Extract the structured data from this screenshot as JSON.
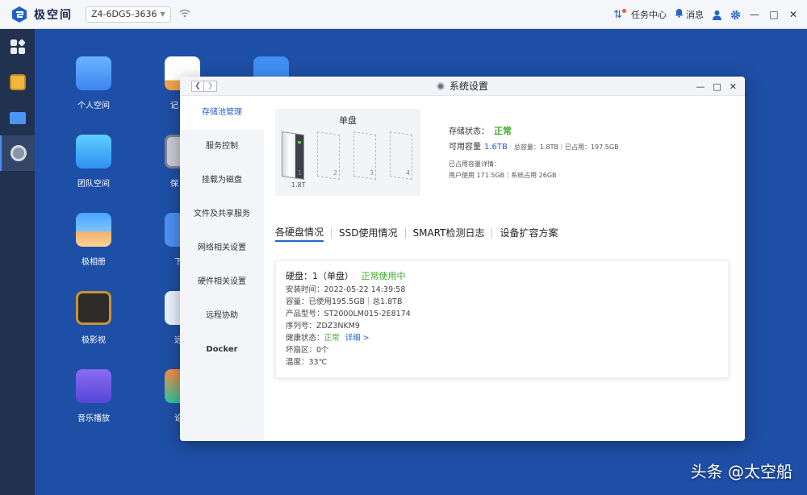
{
  "topbar": {
    "app_name": "极空间",
    "device": "Z4-6DG5-3636",
    "task_center": "任务中心",
    "messages": "消息"
  },
  "desktop": {
    "icons": [
      {
        "label": "个人空间",
        "icon": "folder-icon"
      },
      {
        "label": "团队空间",
        "icon": "team-folder-icon"
      },
      {
        "label": "极相册",
        "icon": "photo-album-icon"
      },
      {
        "label": "极影视",
        "icon": "video-icon"
      },
      {
        "label": "音乐播放",
        "icon": "music-icon"
      },
      {
        "label": "记",
        "icon": "notes-icon"
      },
      {
        "label": "保",
        "icon": "safe-icon"
      },
      {
        "label": "下",
        "icon": "download-icon"
      },
      {
        "label": "远",
        "icon": "remote-icon"
      },
      {
        "label": "论",
        "icon": "chat-icon"
      }
    ]
  },
  "window": {
    "title": "系统设置",
    "menu": [
      "存储池管理",
      "服务控制",
      "挂载为磁盘",
      "文件及共享服务",
      "网络相关设置",
      "硬件相关设置",
      "远程协助",
      "Docker"
    ],
    "disk_panel": {
      "title": "单盘",
      "bays": [
        "1",
        "2",
        "3",
        "4"
      ],
      "capacity_label": "1.8T"
    },
    "status": {
      "storage_label": "存储状态：",
      "storage_value": "正常",
      "available_label": "可用容量",
      "available_value": "1.6TB",
      "total_used": "总容量：1.8TB｜已占用：197.5GB",
      "detail_title": "已占用容量详情：",
      "detail_value": "用户使用 171.5GB｜系统占用 26GB"
    },
    "tabs": [
      "各硬盘情况",
      "SSD使用情况",
      "SMART检测日志",
      "设备扩容方案"
    ],
    "disk_card": {
      "title_prefix": "硬盘：1（单盘）",
      "title_status": "正常使用中",
      "install_time": "安装时间：2022-05-22 14:39:58",
      "capacity": "容量：已使用195.5GB｜总1.8TB",
      "model": "产品型号：ST2000LM015-2E8174",
      "serial": "序列号：ZDZ3NKM9",
      "health_label": "健康状态：",
      "health_value": "正常",
      "health_link": "详细 >",
      "bad_sectors": "坏扇区：0个",
      "temperature": "温度：33℃"
    }
  },
  "watermark": "头条 @太空船",
  "colors": {
    "accent": "#2462c8",
    "ok_green": "#3fae2a",
    "desktop_bg": "#1e4fa6"
  }
}
